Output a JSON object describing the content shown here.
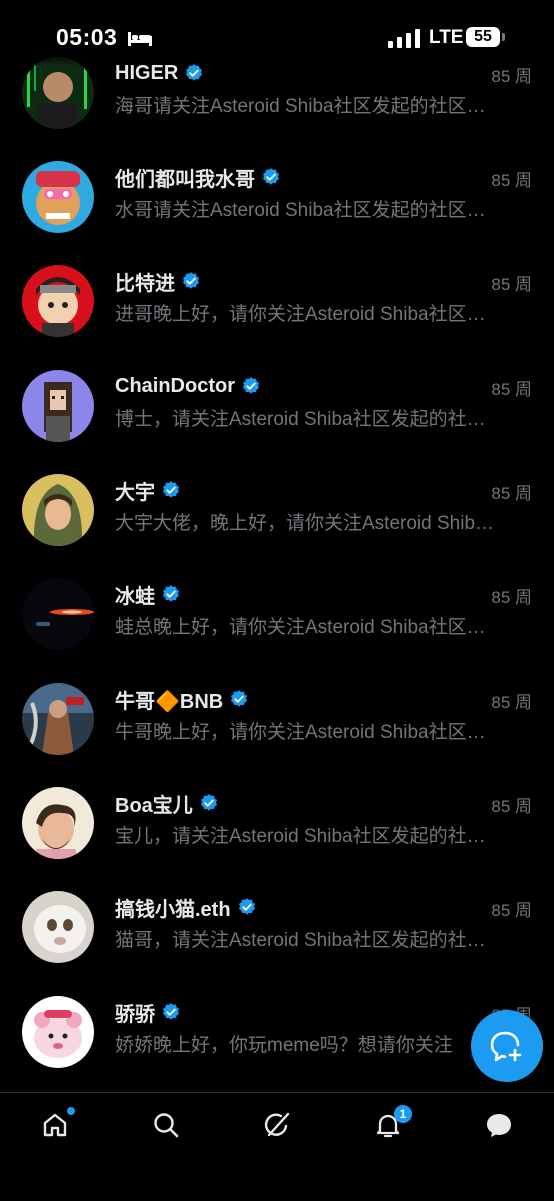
{
  "status_bar": {
    "time": "05:03",
    "network": "LTE",
    "battery": "55"
  },
  "conversations": [
    {
      "name": "HIGER",
      "time": "85 周",
      "preview": "海哥请关注Asteroid Shiba社区发起的社区投票",
      "verified": true
    },
    {
      "name": "他们都叫我水哥",
      "time": "85 周",
      "preview": "水哥请关注Asteroid Shiba社区发起的社区投票",
      "verified": true
    },
    {
      "name": "比特进",
      "time": "85 周",
      "preview": "进哥晚上好，请你关注Asteroid Shiba社区发起的投票",
      "verified": true
    },
    {
      "name": "ChainDoctor",
      "time": "85 周",
      "preview": "博士，请关注Asteroid Shiba社区发起的社区投票",
      "verified": true
    },
    {
      "name": "大宇",
      "time": "85 周",
      "preview": "大宇大佬，晚上好，请你关注Asteroid Shiba社区发起的投票",
      "verified": true
    },
    {
      "name": "冰蛙",
      "time": "85 周",
      "preview": "蛙总晚上好，请你关注Asteroid Shiba社区发起的投票",
      "verified": true
    },
    {
      "name": "牛哥🔶BNB",
      "time": "85 周",
      "preview": "牛哥晚上好，请你关注Asteroid Shiba社区发起的投票",
      "verified": true
    },
    {
      "name": "Boa宝儿",
      "time": "85 周",
      "preview": "宝儿，请关注Asteroid Shiba社区发起的社区投票",
      "verified": true
    },
    {
      "name": "搞钱小猫.eth",
      "time": "85 周",
      "preview": "猫哥，请关注Asteroid Shiba社区发起的社区投票",
      "verified": true
    },
    {
      "name": "骄骄",
      "time": "85 周",
      "preview": "娇娇晚上好，你玩meme吗？想请你关注",
      "verified": true
    }
  ],
  "fab": {
    "icon": "new-message-icon"
  },
  "bottom_nav": {
    "items": [
      "home-icon",
      "search-icon",
      "grok-icon",
      "notifications-icon",
      "messages-icon"
    ],
    "notifications_badge": "1"
  },
  "colors": {
    "accent": "#1d9bf0",
    "background": "#000000",
    "muted": "#71767b"
  }
}
